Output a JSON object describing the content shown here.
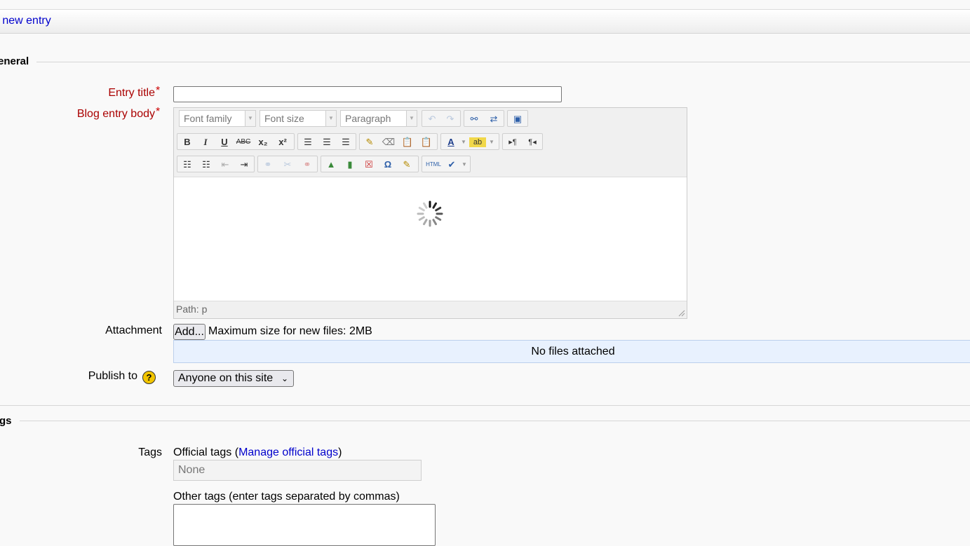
{
  "header": {
    "link": "a new entry"
  },
  "sections": {
    "general": "eneral",
    "tags": "gs"
  },
  "form": {
    "entry_title_label": "Entry title",
    "entry_title_value": "",
    "blog_body_label": "Blog entry body",
    "required_mark": "*",
    "attachment_label": "Attachment",
    "add_button": "Add...",
    "max_size_text": "Maximum size for new files: 2MB",
    "no_files_text": "No files attached",
    "publish_label": "Publish to",
    "help_icon": "?",
    "publish_value": "Anyone on this site"
  },
  "editor": {
    "font_family": "Font family",
    "font_size": "Font size",
    "format": "Paragraph",
    "path": "Path: p",
    "loading": true
  },
  "tags": {
    "label": "Tags",
    "official_prefix": "Official tags (",
    "manage_link": "Manage official tags",
    "official_suffix": ")",
    "official_value": "None",
    "other_label": "Other tags (enter tags separated by commas)",
    "other_value": ""
  }
}
